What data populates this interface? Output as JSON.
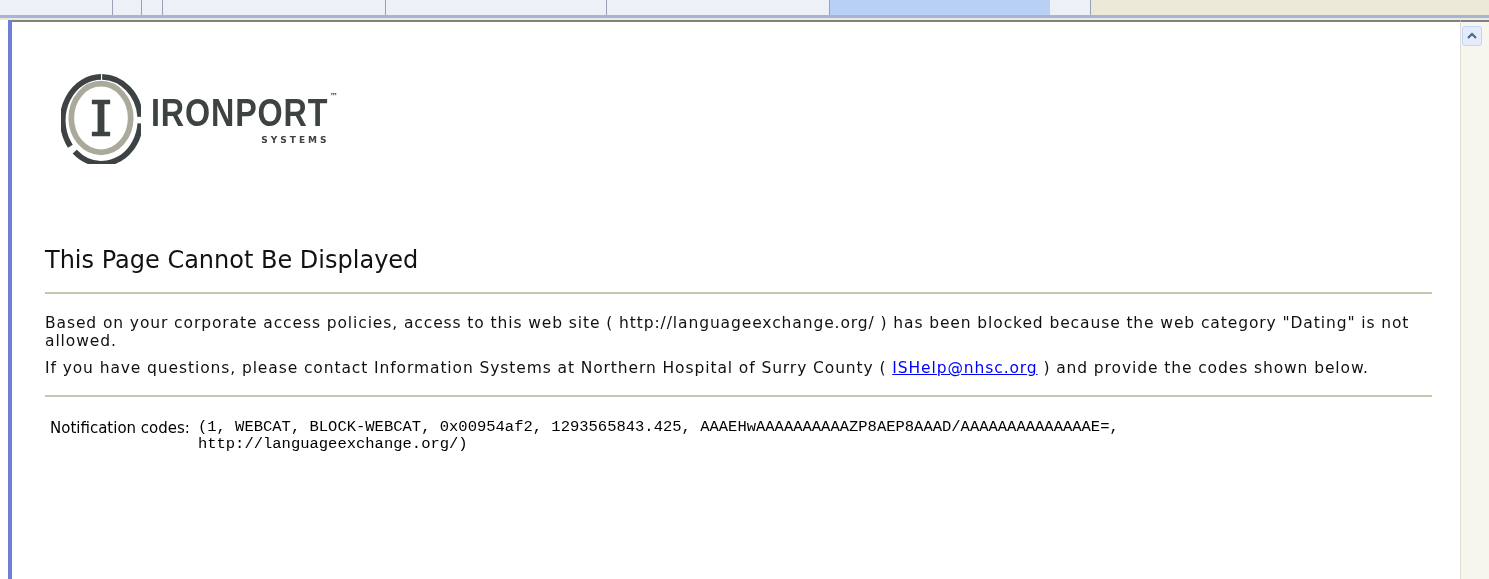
{
  "logo": {
    "brand": "IRONPORT",
    "trademark": "™",
    "subtitle": "SYSTEMS"
  },
  "heading": "This Page Cannot Be Displayed",
  "message": "Based on your corporate access policies, access to this web site ( http://languageexchange.org/ ) has been blocked because the web category \"Dating\" is not allowed.",
  "contact": {
    "before": "If you have questions, please contact Information Systems at Northern Hospital of Surry County ( ",
    "link": "ISHelp@nhsc.org",
    "after": " ) and provide the codes shown below."
  },
  "notification": {
    "label": "Notification codes:",
    "value": "(1, WEBCAT, BLOCK-WEBCAT, 0x00954af2, 1293565843.425, AAAEHwAAAAAAAAAAZP8AEP8AAAD/AAAAAAAAAAAAAAE=, http://languageexchange.org/)"
  }
}
